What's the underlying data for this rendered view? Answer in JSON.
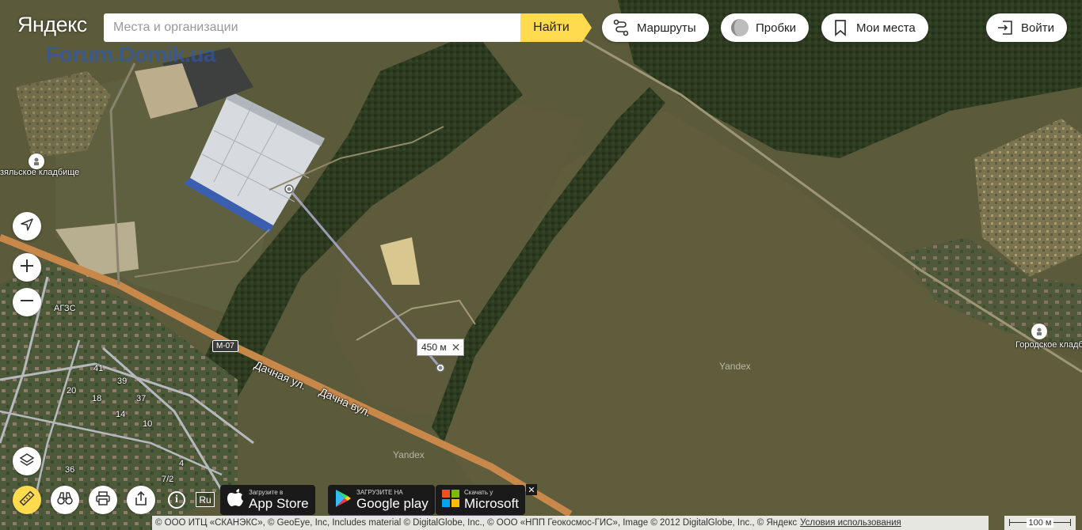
{
  "header": {
    "logo": "Яндекс",
    "search_placeholder": "Места и организации",
    "find_label": "Найти",
    "routes_label": "Маршруты",
    "traffic_label": "Пробки",
    "my_places_label": "Мои места",
    "login_label": "Войти"
  },
  "map": {
    "watermark": "Forum.Domik.ua",
    "labels": {
      "cemetery_left": "зяльское кладбище",
      "cemetery_right": "Городское кладбище",
      "gas_station": "АГЗС",
      "road_shield": "М-07",
      "street": "Дачная ул.",
      "street_ua": "Дачна вул.",
      "yandex_wm_1": "Yandex",
      "yandex_wm_2": "Yandex",
      "house_numbers": [
        "41",
        "39",
        "20",
        "18",
        "37",
        "14",
        "10",
        "36",
        "7/2",
        "4"
      ]
    },
    "ruler_distance": "450 м"
  },
  "icons": {
    "routes": "route-icon",
    "traffic": "traffic-light-icon",
    "my_places": "bookmark-icon",
    "login": "login-arrow-icon",
    "locate": "location-arrow-icon",
    "zoom_in": "plus-icon",
    "zoom_out": "minus-icon",
    "layers": "layers-icon",
    "ruler": "ruler-icon",
    "panorama": "binoculars-icon",
    "print": "printer-icon",
    "share": "share-icon"
  },
  "bottom": {
    "app_store_small": "Загрузите в",
    "app_store_big": "App Store",
    "google_play_small": "ЗАГРУЗИТЕ НА",
    "google_play_big": "Google play",
    "microsoft_small": "Скачать у",
    "microsoft_big": "Microsoft",
    "close_label": "✕",
    "info_label": "i",
    "language_label": "Ru",
    "copyright": "© ООО ИТЦ «СКАНЭКС», © GeoEye, Inc, Includes material © DigitalGlobe, Inc., © ООО «НПП Геокосмос-ГИС», Image © 2012 DigitalGlobe, Inc., © Яндекс",
    "terms_link": "Условия использования",
    "scale_label": "100 м"
  },
  "colors": {
    "accent": "#ffdb4d",
    "field": "#5e5b3b",
    "forest": "#2c3a1d",
    "road": "#c8884a"
  }
}
